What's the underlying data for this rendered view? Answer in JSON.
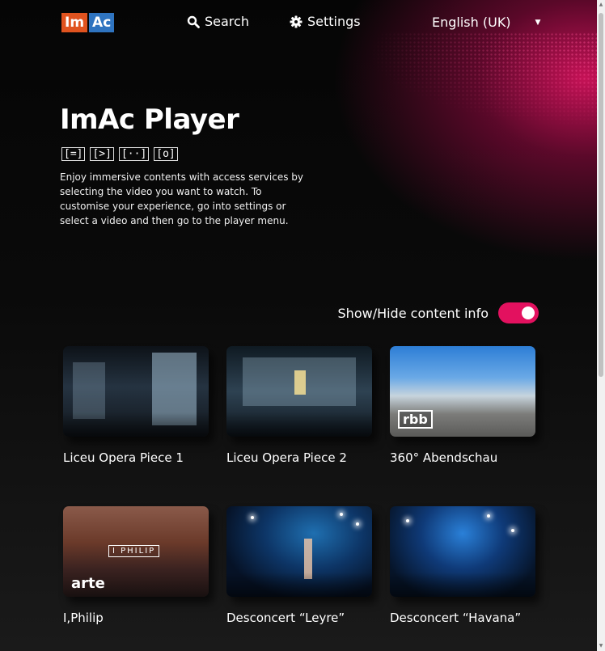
{
  "header": {
    "logo": {
      "part1": "Im",
      "part2": "Ac"
    },
    "search_label": "Search",
    "search_icon": "search-icon",
    "settings_label": "Settings",
    "settings_icon": "gear-icon",
    "language": "English (UK)",
    "language_icon": "chevron-down-icon"
  },
  "hero": {
    "title": "ImAc Player",
    "access_icons": [
      "[=]",
      "[>]",
      "[··]",
      "[o]"
    ],
    "description": "Enjoy immersive contents with access services by selecting the video you want to watch. To customise your experience, go into settings or select a video and then go to the player menu."
  },
  "toggle": {
    "label": "Show/Hide content info",
    "on": true,
    "color": "#e3115f"
  },
  "videos": [
    {
      "title": "Liceu Opera Piece 1"
    },
    {
      "title": "Liceu Opera Piece 2"
    },
    {
      "title": "360° Abendschau",
      "badge": "rbb"
    },
    {
      "title": "I,Philip",
      "badge": "arte",
      "poster_text": "I PHILIP"
    },
    {
      "title": "Desconcert “Leyre”"
    },
    {
      "title": "Desconcert “Havana”"
    }
  ],
  "colors": {
    "accent": "#e3115f",
    "logo_orange": "#e0531f",
    "logo_blue": "#2f74c0"
  }
}
